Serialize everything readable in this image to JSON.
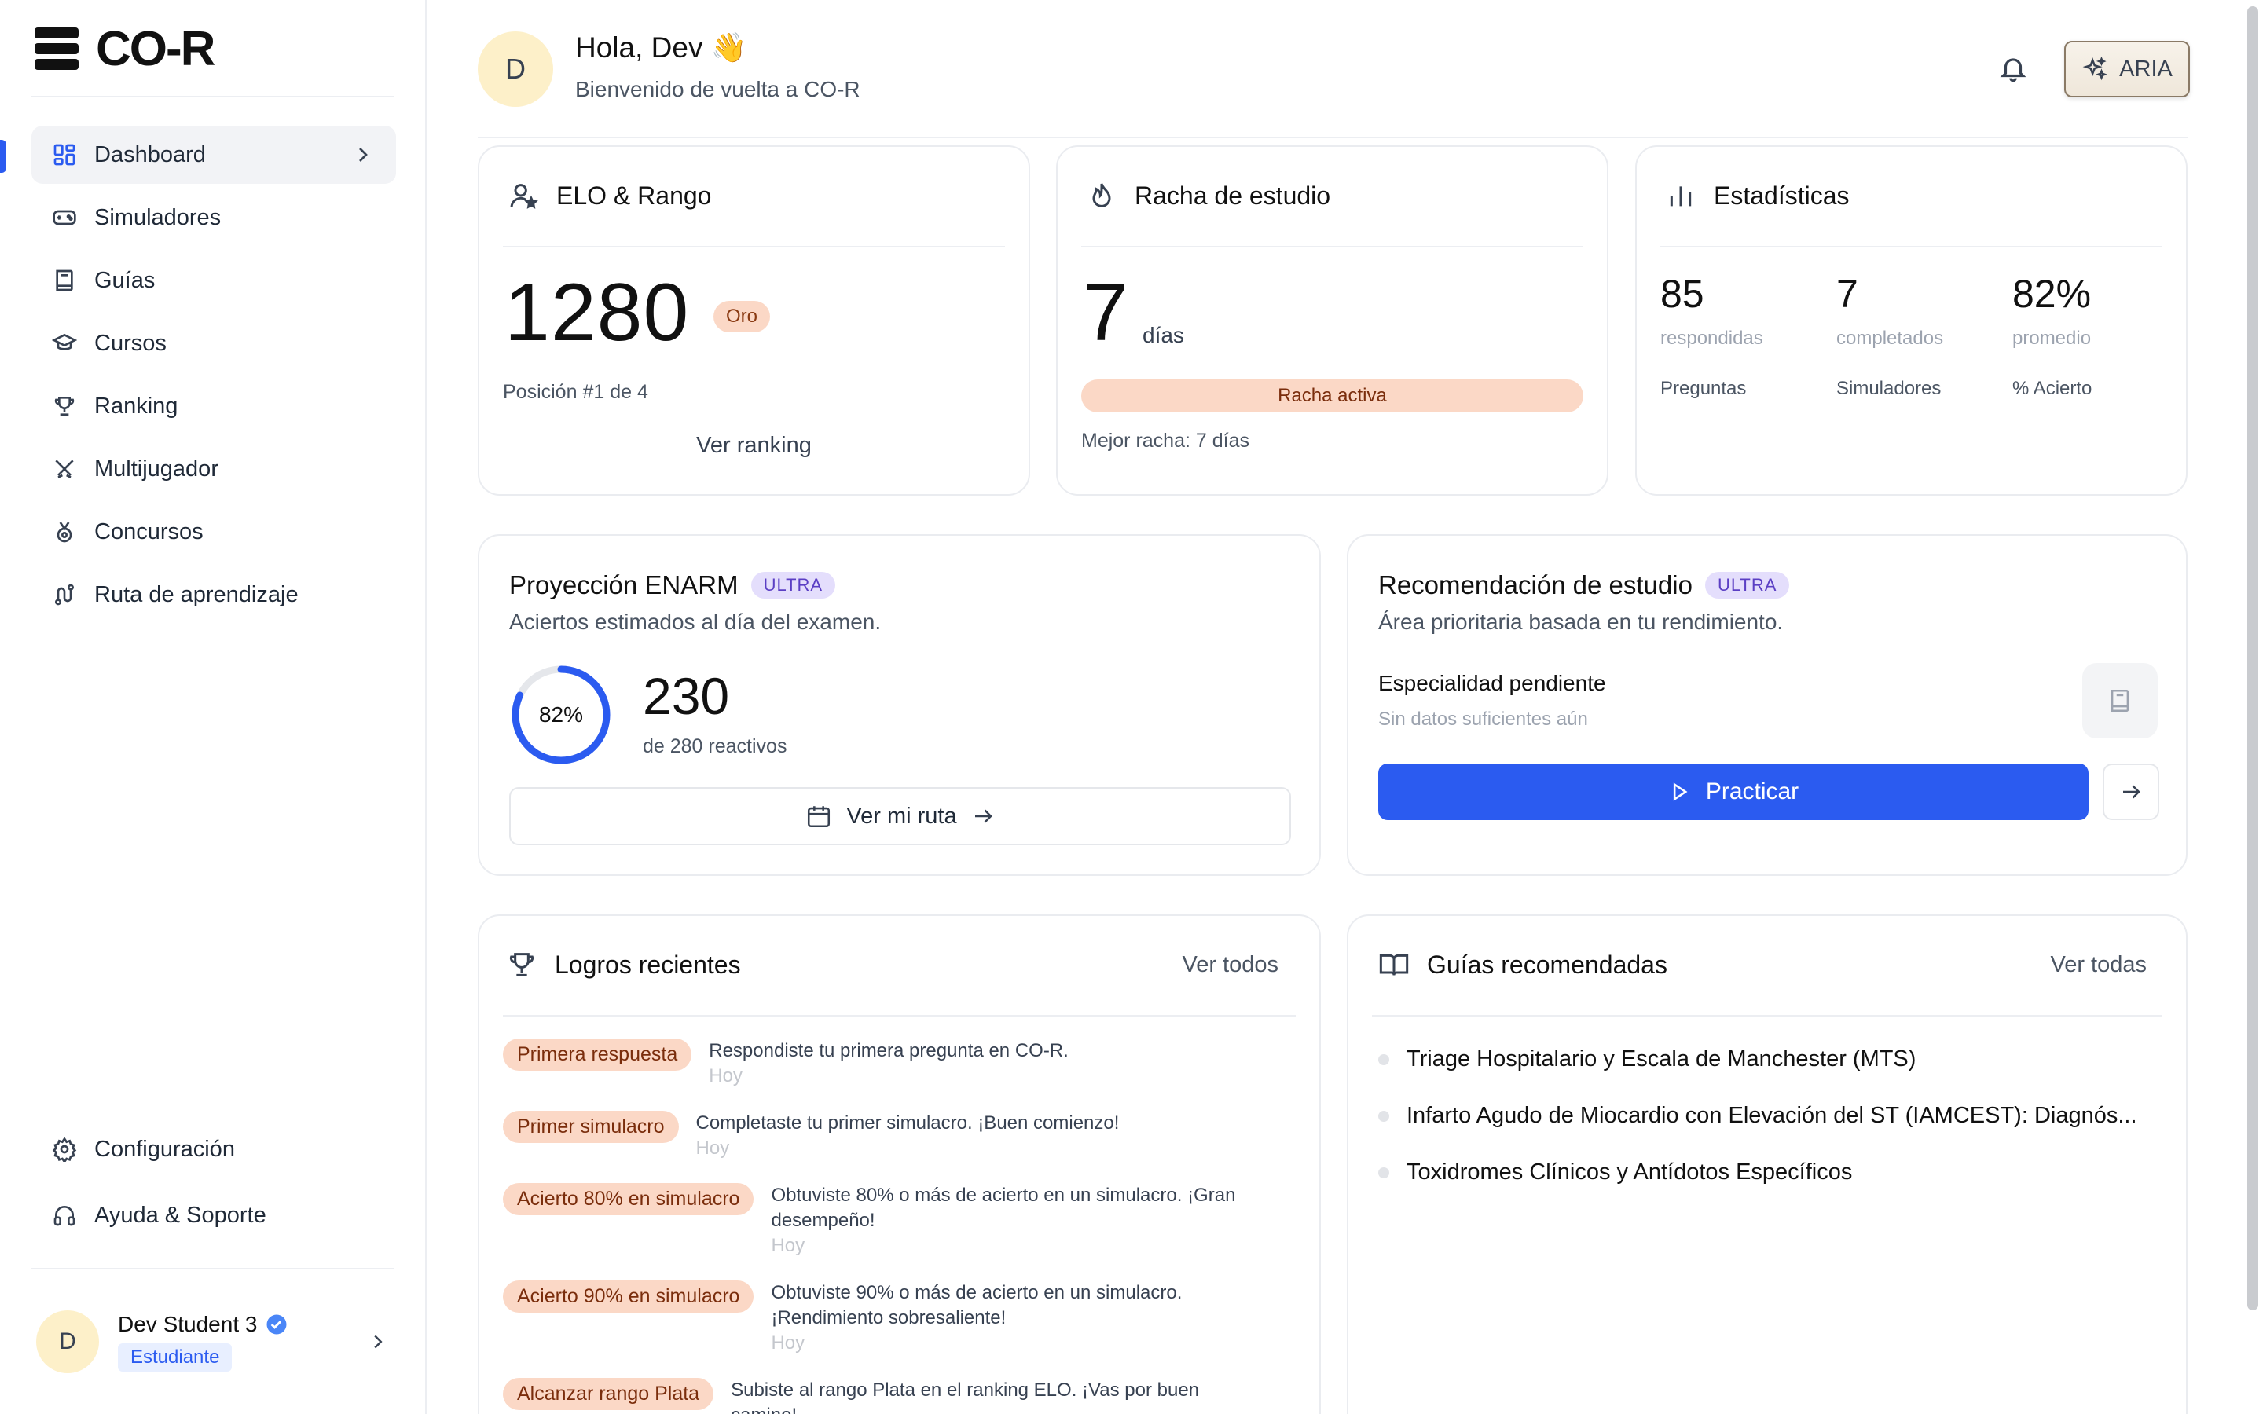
{
  "brand": {
    "name": "CO-R"
  },
  "sidebar": {
    "items": [
      {
        "label": "Dashboard",
        "icon": "dashboard-icon",
        "active": true
      },
      {
        "label": "Simuladores",
        "icon": "gamepad-icon"
      },
      {
        "label": "Guías",
        "icon": "book-icon"
      },
      {
        "label": "Cursos",
        "icon": "graduation-cap-icon"
      },
      {
        "label": "Ranking",
        "icon": "trophy-icon"
      },
      {
        "label": "Multijugador",
        "icon": "swords-icon"
      },
      {
        "label": "Concursos",
        "icon": "medal-icon"
      },
      {
        "label": "Ruta de aprendizaje",
        "icon": "route-icon"
      }
    ],
    "bottom_items": [
      {
        "label": "Configuración",
        "icon": "gear-icon"
      },
      {
        "label": "Ayuda & Soporte",
        "icon": "headphones-icon"
      }
    ],
    "user": {
      "initial": "D",
      "name": "Dev Student 3",
      "role": "Estudiante"
    }
  },
  "header": {
    "avatar_initial": "D",
    "greeting": "Hola, Dev 👋",
    "subtitle": "Bienvenido de vuelta a CO-R",
    "aria_label": "ARIA"
  },
  "elo": {
    "title": "ELO & Rango",
    "score": "1280",
    "rank": "Oro",
    "position": "Posición #1 de 4",
    "link": "Ver ranking"
  },
  "streak": {
    "title": "Racha de estudio",
    "days": "7",
    "unit": "días",
    "status": "Racha activa",
    "best": "Mejor racha: 7 días"
  },
  "stats": {
    "title": "Estadísticas",
    "items": [
      {
        "value": "85",
        "sub": "respondidas",
        "label": "Preguntas"
      },
      {
        "value": "7",
        "sub": "completados",
        "label": "Simuladores"
      },
      {
        "value": "82%",
        "sub": "promedio",
        "label": "% Acierto"
      }
    ]
  },
  "projection": {
    "title": "Proyección ENARM",
    "badge": "ULTRA",
    "subtitle": "Aciertos estimados al día del examen.",
    "percent_label": "82%",
    "percent": 82,
    "value": "230",
    "of": "de 280 reactivos",
    "button": "Ver mi ruta"
  },
  "recommendation": {
    "title": "Recomendación de estudio",
    "badge": "ULTRA",
    "subtitle": "Área prioritaria basada en tu rendimiento.",
    "specialty": "Especialidad pendiente",
    "note": "Sin datos suficientes aún",
    "button": "Practicar"
  },
  "achievements": {
    "title": "Logros recientes",
    "link": "Ver todos",
    "items": [
      {
        "badge": "Primera respuesta",
        "line1": "Respondiste tu primera pregunta en CO-R.",
        "line2": "",
        "time": "Hoy"
      },
      {
        "badge": "Primer simulacro",
        "line1": "Completaste tu primer simulacro. ¡Buen comienzo!",
        "line2": "",
        "time": "Hoy"
      },
      {
        "badge": "Acierto 80% en simulacro",
        "line1": "Obtuviste 80% o más de acierto en un simulacro. ¡Gran",
        "line2": "desempeño!",
        "time": "Hoy"
      },
      {
        "badge": "Acierto 90% en simulacro",
        "line1": "Obtuviste 90% o más de acierto en un simulacro.",
        "line2": "¡Rendimiento sobresaliente!",
        "time": "Hoy"
      },
      {
        "badge": "Alcanzar rango Plata",
        "line1": "Subiste al rango Plata en el ranking ELO. ¡Vas por buen",
        "line2": "camino!",
        "time": ""
      }
    ]
  },
  "guides": {
    "title": "Guías recomendadas",
    "link": "Ver todas",
    "items": [
      "Triage Hospitalario y Escala de Manchester (MTS)",
      "Infarto Agudo de Miocardio con Elevación del ST (IAMCEST): Diagnós...",
      "Toxidromes Clínicos y Antídotos Específicos"
    ]
  },
  "colors": {
    "accent": "#2b5bf0",
    "badge_orange": "#fbd8c6",
    "badge_ultra": "#e4defc"
  }
}
